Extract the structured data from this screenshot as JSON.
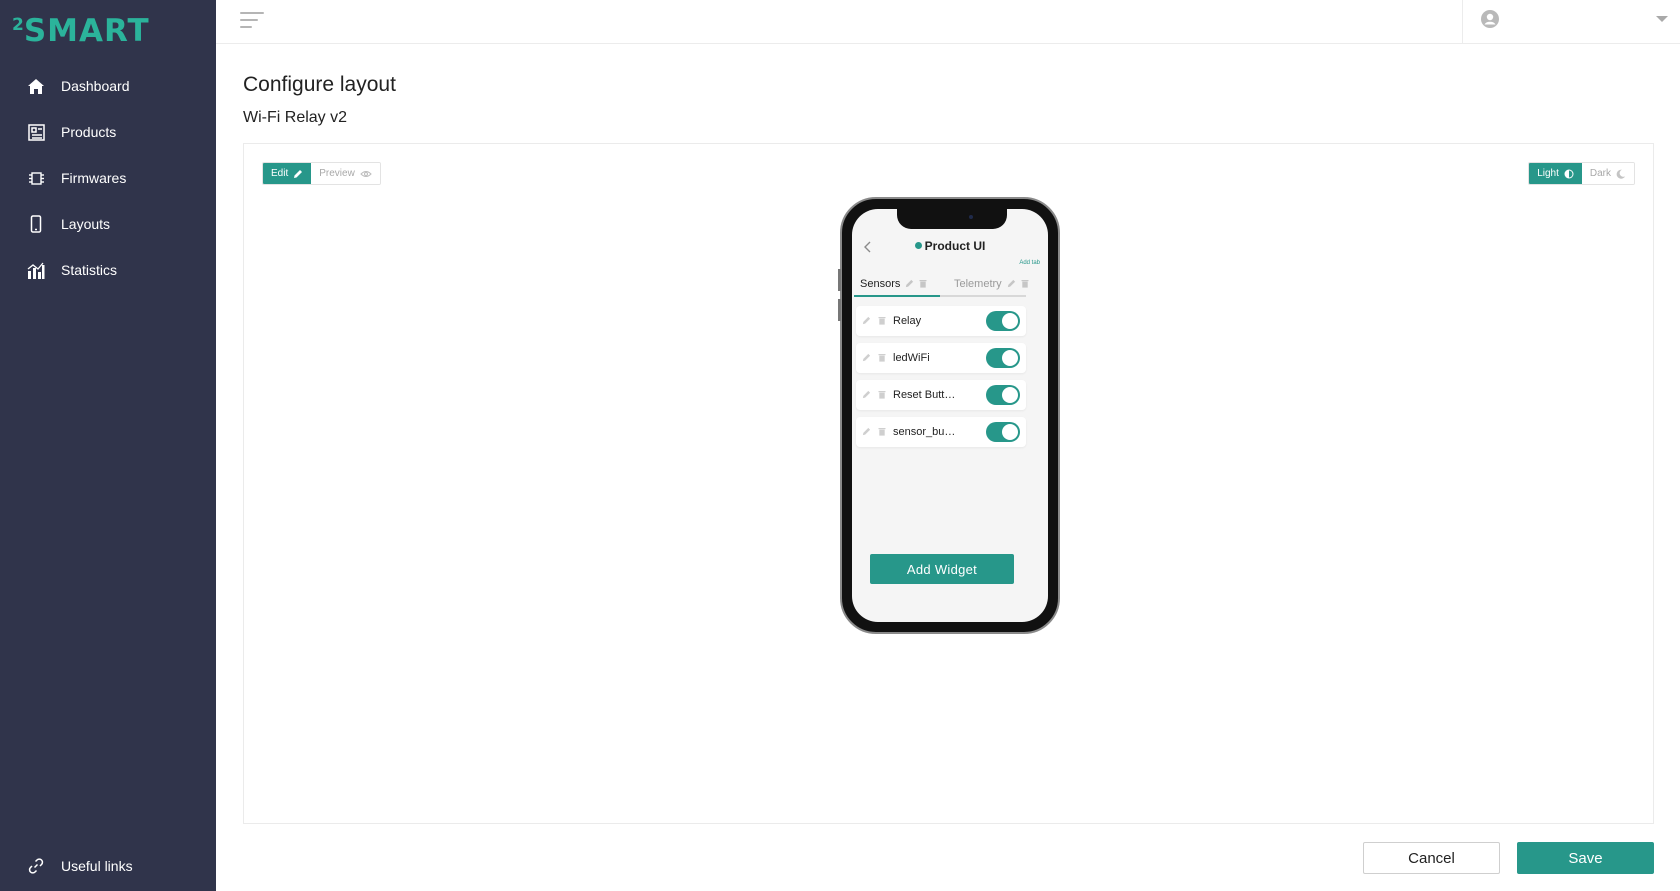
{
  "brand": {
    "logo_sup": "2",
    "logo_text": "SMART",
    "accent": "#2bb39b"
  },
  "sidebar": {
    "items": [
      {
        "label": "Dashboard",
        "icon": "home-icon"
      },
      {
        "label": "Products",
        "icon": "products-icon"
      },
      {
        "label": "Firmwares",
        "icon": "firmware-chip-icon"
      },
      {
        "label": "Layouts",
        "icon": "phone-icon"
      },
      {
        "label": "Statistics",
        "icon": "bar-chart-icon"
      }
    ],
    "footer_link": {
      "label": "Useful links",
      "icon": "link-icon"
    }
  },
  "topbar": {
    "menu_icon": "menu-lines-icon",
    "user_icon": "user-circle-icon",
    "caret_icon": "caret-down-icon"
  },
  "page": {
    "title": "Configure layout",
    "subtitle": "Wi-Fi Relay v2"
  },
  "mode_switch": {
    "edit_label": "Edit",
    "preview_label": "Preview",
    "selected": "Edit"
  },
  "theme_switch": {
    "light_label": "Light",
    "dark_label": "Dark",
    "selected": "Light"
  },
  "phone": {
    "title": "Product UI",
    "add_tab_label": "Add tab",
    "tabs": [
      {
        "label": "Sensors",
        "active": true
      },
      {
        "label": "Telemetry",
        "active": false
      }
    ],
    "widgets": [
      {
        "label": "Relay",
        "on": true
      },
      {
        "label": "ledWiFi",
        "on": true
      },
      {
        "label": "Reset Butt…",
        "on": true
      },
      {
        "label": "sensor_bu…",
        "on": true
      }
    ],
    "add_widget_label": "Add Widget"
  },
  "actions": {
    "cancel_label": "Cancel",
    "save_label": "Save",
    "primary_color": "#27978a"
  }
}
